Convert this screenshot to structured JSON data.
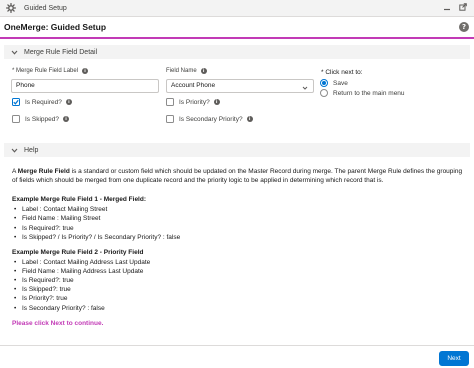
{
  "utility_bar": {
    "title": "Guided Setup"
  },
  "header": {
    "title": "OneMerge: Guided Setup",
    "help_glyph": "?"
  },
  "section_detail": {
    "label": "Merge Rule Field Detail"
  },
  "form": {
    "merge_label": {
      "label": "* Merge Rule Field Label",
      "value": "Phone"
    },
    "field_name": {
      "label": "Field Name",
      "value": "Account Phone"
    },
    "checkboxes": {
      "is_required": {
        "label": "Is Required?",
        "checked": true
      },
      "is_skipped": {
        "label": "Is Skipped?",
        "checked": false
      },
      "is_priority": {
        "label": "Is Priority?",
        "checked": false
      },
      "is_secondary_priority": {
        "label": "Is Secondary Priority?",
        "checked": false
      }
    },
    "next_action": {
      "label": "* Click next to:",
      "options": [
        {
          "label": "Save",
          "selected": true
        },
        {
          "label": "Return to the main menu",
          "selected": false
        }
      ]
    }
  },
  "section_help": {
    "label": "Help",
    "intro_prefix": "A ",
    "intro_bold": "Merge Rule Field",
    "intro_rest": " is a standard or custom field which should be updated on the Master Record during merge. The parent Merge Rule defines the grouping of fields which should be merged from one duplicate record and the priority logic to be applied in determining which record that is.",
    "example1": {
      "title": "Example Merge Rule Field 1 - Merged Field:",
      "items": [
        "Label : Contact Mailing Street",
        "Field Name : Mailing Street",
        "Is Required?: true",
        "Is Skipped? / Is Priority? / Is Secondary Priority? : false"
      ]
    },
    "example2": {
      "title": "Example Merge Rule Field 2 - Priority Field",
      "items": [
        "Label : Contact Mailing Address Last Update",
        "Field Name : Mailing Address Last Update",
        "Is Required?: true",
        "Is Skipped?: true",
        "Is Priority?: true",
        "Is Secondary Priority? : false"
      ]
    },
    "notice": "Please click Next to continue."
  },
  "footer": {
    "next_label": "Next"
  },
  "icons": {
    "app": "gear-icon",
    "window": [
      "minimize-icon",
      "popout-icon"
    ],
    "section_toggle": "chevron-down-icon",
    "info": "info-icon",
    "help": "help-icon"
  },
  "colors": {
    "accent": "#c23ab6",
    "brand_button": "#0176d3",
    "section_bg": "#f3f3f3"
  }
}
